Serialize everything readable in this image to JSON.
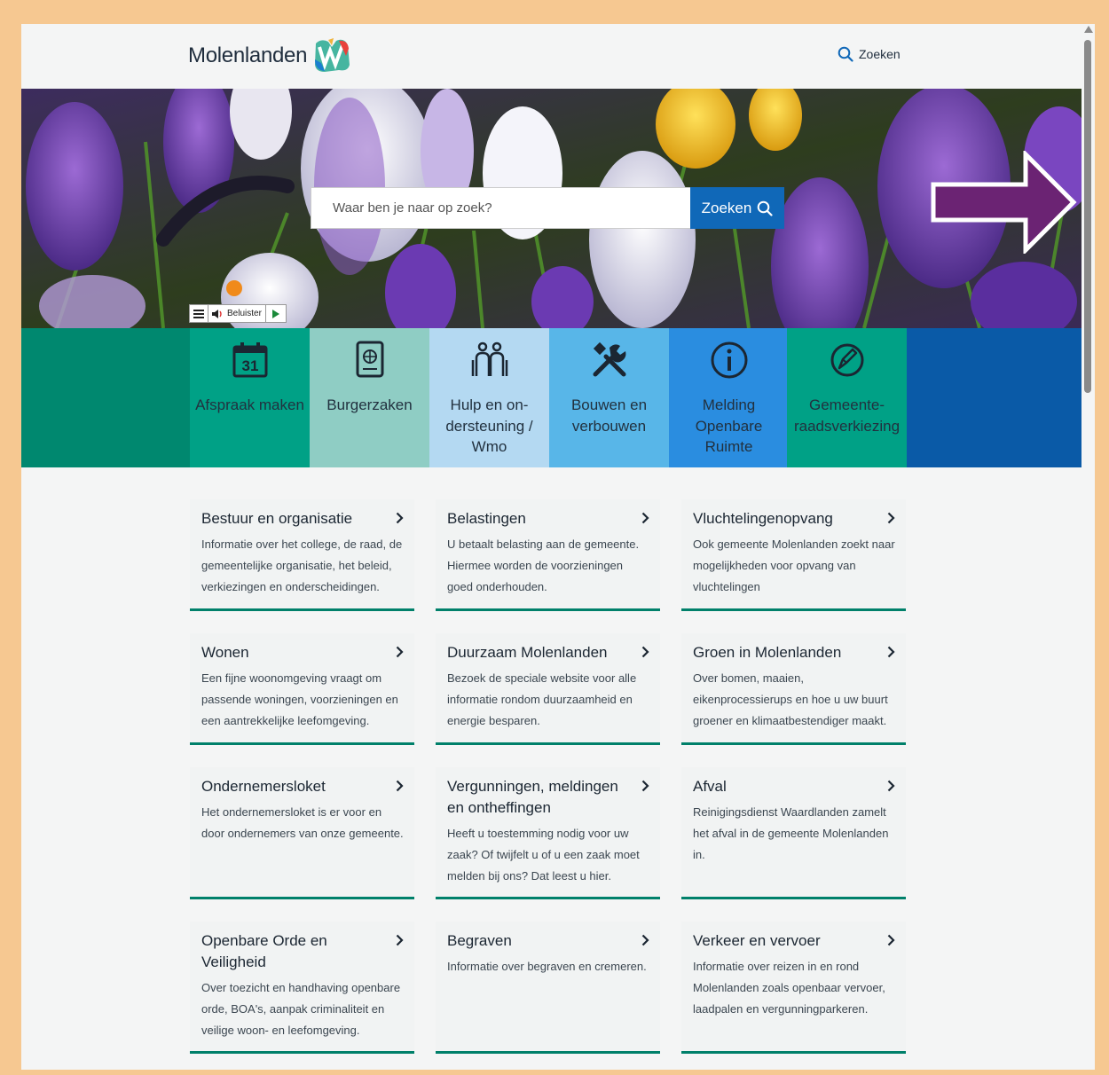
{
  "header": {
    "logo_text": "Molenlanden",
    "search_label": "Zoeken"
  },
  "hero": {
    "search_placeholder": "Waar ben je naar op zoek?",
    "search_button_label": "Zoeken",
    "readspeaker_label": "Beluister"
  },
  "tiles": [
    {
      "label": "Afspraak maken",
      "icon": "calendar-icon",
      "color": "#00a186"
    },
    {
      "label": "Burgerzaken",
      "icon": "passport-icon",
      "color": "#8fcdc4"
    },
    {
      "label": "Hulp en on­dersteuning / Wmo",
      "icon": "people-icon",
      "color": "#b4d9f2"
    },
    {
      "label": "Bouwen en verbouwen",
      "icon": "tools-icon",
      "color": "#58b6e8"
    },
    {
      "label": "Melding Openbare Ruimte",
      "icon": "info-icon",
      "color": "#2a8de0"
    },
    {
      "label": "Gemeente­raadsverkie­zing",
      "icon": "vote-icon",
      "color": "#00a186"
    }
  ],
  "tile_left_color": "#00886f",
  "tile_right_color": "#0a5aa7",
  "cards": [
    {
      "title": "Bestuur en organisatie",
      "description": "Informatie over het college, de raad, de gemeentelijke organisatie, het beleid, verkiezingen en onderscheidingen."
    },
    {
      "title": "Belastingen",
      "description": "U betaalt belasting aan de gemeente. Hiermee worden de voorzieningen goed onderhouden."
    },
    {
      "title": "Vluchtelingenopvang",
      "description": "Ook gemeente Molenlanden zoekt naar mogelijkheden voor opvang van vluchtelingen"
    },
    {
      "title": "Wonen",
      "description": "Een fijne woonomgeving vraagt om passende woningen, voorzieningen en een aantrekkelijke leefomgeving."
    },
    {
      "title": "Duurzaam Molenlanden",
      "description": "Bezoek de speciale website voor alle informatie rondom duurzaamheid en energie besparen."
    },
    {
      "title": "Groen in Molenlanden",
      "description": "Over bomen, maaien, eikenprocessierups en hoe u uw buurt groener en klimaatbestendiger maakt."
    },
    {
      "title": "Ondernemersloket",
      "description": "Het ondernemersloket is er voor en door ondernemers van onze gemeente."
    },
    {
      "title": "Vergunningen, meldingen en ontheffingen",
      "description": "Heeft u toestemming nodig voor uw zaak? Of twijfelt u of u een zaak moet melden bij ons? Dat leest u hier."
    },
    {
      "title": "Afval",
      "description": "Reinigingsdienst Waardlanden zamelt het afval in de gemeente Molenlanden in."
    },
    {
      "title": "Openbare Orde en Veiligheid",
      "description": "Over toezicht en handhaving openbare orde, BOA's, aanpak criminaliteit en veilige woon- en leefomgeving."
    },
    {
      "title": "Begraven",
      "description": "Informatie over begraven en cremeren."
    },
    {
      "title": "Verkeer en vervoer",
      "description": "Informatie over reizen in en rond Molenlanden zoals openbaar vervoer, laadpalen en vergunningparkeren."
    }
  ],
  "accent_color": "#00806a",
  "annotation_arrow_color": "#6b2373"
}
